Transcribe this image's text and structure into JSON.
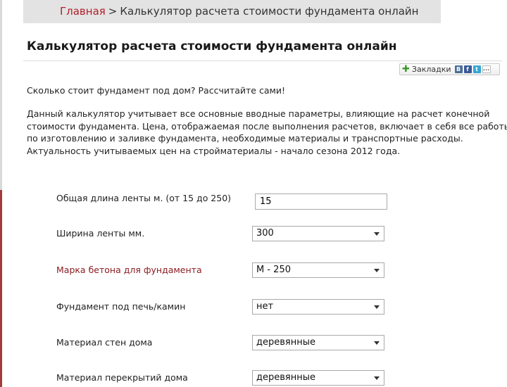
{
  "breadcrumb": {
    "home": "Главная",
    "separator": ">",
    "current": "Калькулятор расчета стоимости фундамента онлайн"
  },
  "page_title": "Калькулятор расчета стоимости фундамента онлайн",
  "bookmarks": {
    "label": "Закладки",
    "icons": [
      "plus-icon",
      "vk-icon",
      "facebook-icon",
      "twitter-icon",
      "more-icon"
    ],
    "glyphs": {
      "vk": "B",
      "fb": "f",
      "tw": "t",
      "more": "..."
    }
  },
  "lead": "Сколько стоит фундамент под дом? Рассчитайте сами!",
  "description": [
    "Данный калькулятор учитывает все основные вводные параметры, влияющие на расчет конечной",
    "стоимости фундамента. Цена, отображаемая после выполнения расчетов, включает в себя все работы",
    "по изготовлению и заливке фундамента, необходимые материалы и транспортные расходы.",
    "Актуальность учитываемых цен на стройматериалы - начало сезона 2012 года."
  ],
  "form": {
    "length_label": "Общая длина ленты м. (от 15 до 250)",
    "length_value": "15",
    "width_label": "Ширина ленты мм.",
    "width_value": "300",
    "concrete_label": "Марка бетона для фундамента",
    "concrete_value": "М - 250",
    "stove_label": "Фундамент под печь/камин",
    "stove_value": "нет",
    "walls_label": "Материал стен дома",
    "walls_value": "деревянные",
    "floors_label": "Материал перекрытий дома",
    "floors_value": "деревянные"
  },
  "colors": {
    "link": "#b2202a",
    "accent_label": "#8c1d22",
    "breadcrumb_bg": "#e3e3e3"
  }
}
